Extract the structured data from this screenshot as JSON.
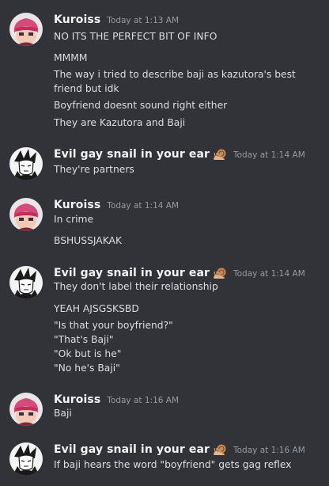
{
  "users": {
    "kuroiss": {
      "name": "Kuroiss",
      "avatar_icon": "pink-haired-anime-avatar"
    },
    "snail": {
      "name": "Evil gay snail in your ear",
      "badge_icon": "snail-emoji",
      "avatar_icon": "monochrome-manga-avatar"
    }
  },
  "messages": [
    {
      "author": "Kuroiss",
      "time": "Today at 1:13 AM",
      "lines": [
        "NO ITS THE PERFECT BIT OF INFO",
        "MMMM",
        "The way i tried to describe baji as kazutora's best friend but idk",
        "Boyfriend doesnt sound right either",
        "They are Kazutora and Baji"
      ]
    },
    {
      "author": "Evil gay snail in your ear",
      "time": "Today at 1:14 AM",
      "lines": [
        "They're partners"
      ]
    },
    {
      "author": "Kuroiss",
      "time": "Today at 1:14 AM",
      "lines": [
        "In crime",
        "BSHUSSJAKAK"
      ]
    },
    {
      "author": "Evil gay snail in your ear",
      "time": "Today at 1:14 AM",
      "lines": [
        "They don't label their relationship",
        "YEAH AJSGSKSBD",
        "\"Is that your boyfriend?\"",
        "\"That's Baji\"",
        "\"Ok but is he\"",
        "\"No he's Baji\""
      ]
    },
    {
      "author": "Kuroiss",
      "time": "Today at 1:16 AM",
      "lines": [
        "Baji"
      ]
    },
    {
      "author": "Evil gay snail in your ear",
      "time": "Today at 1:16 AM",
      "lines": [
        "If baji hears the word \"boyfriend\" gets gag reflex"
      ]
    }
  ],
  "colors": {
    "background": "#313338",
    "username": "#f2f3f5",
    "text": "#dbdee1",
    "timestamp": "#949ba4"
  }
}
